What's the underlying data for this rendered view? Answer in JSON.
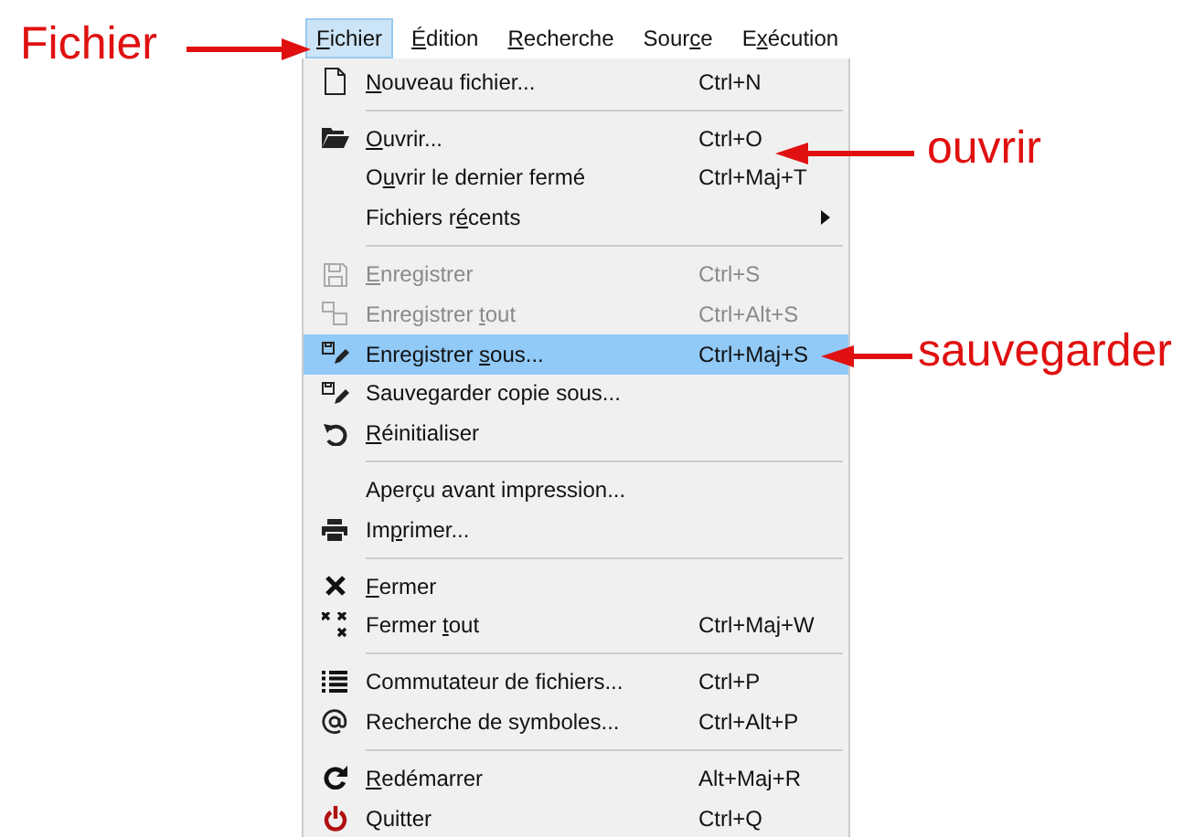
{
  "menubar": [
    {
      "label": "Fichier",
      "selected": true
    },
    {
      "label": "Édition",
      "selected": false
    },
    {
      "label": "Recherche",
      "selected": false
    },
    {
      "label": "Source",
      "selected": false
    },
    {
      "label": "Exécution",
      "selected": false
    }
  ],
  "menu": {
    "entries": [
      {
        "kind": "item",
        "label": "Nouveau fichier...",
        "shortcut": "Ctrl+N",
        "disabled": false,
        "selected": false
      },
      {
        "kind": "separator"
      },
      {
        "kind": "item",
        "label": "Ouvrir...",
        "shortcut": "Ctrl+O",
        "disabled": false,
        "selected": false
      },
      {
        "kind": "item",
        "label": "Ouvrir le dernier fermé",
        "shortcut": "Ctrl+Maj+T",
        "disabled": false,
        "selected": false
      },
      {
        "kind": "item",
        "label": "Fichiers récents",
        "submenu": true,
        "disabled": false,
        "selected": false
      },
      {
        "kind": "separator"
      },
      {
        "kind": "item",
        "label": "Enregistrer",
        "shortcut": "Ctrl+S",
        "disabled": true,
        "selected": false
      },
      {
        "kind": "item",
        "label": "Enregistrer tout",
        "shortcut": "Ctrl+Alt+S",
        "disabled": true,
        "selected": false
      },
      {
        "kind": "item",
        "label": "Enregistrer sous...",
        "shortcut": "Ctrl+Maj+S",
        "disabled": false,
        "selected": true
      },
      {
        "kind": "item",
        "label": "Sauvegarder copie sous...",
        "disabled": false,
        "selected": false
      },
      {
        "kind": "item",
        "label": "Réinitialiser",
        "disabled": false,
        "selected": false
      },
      {
        "kind": "separator"
      },
      {
        "kind": "item",
        "label": "Aperçu avant impression...",
        "disabled": false,
        "selected": false
      },
      {
        "kind": "item",
        "label": "Imprimer...",
        "disabled": false,
        "selected": false
      },
      {
        "kind": "separator"
      },
      {
        "kind": "item",
        "label": "Fermer",
        "disabled": false,
        "selected": false
      },
      {
        "kind": "item",
        "label": "Fermer tout",
        "shortcut": "Ctrl+Maj+W",
        "disabled": false,
        "selected": false
      },
      {
        "kind": "separator"
      },
      {
        "kind": "item",
        "label": "Commutateur de fichiers...",
        "shortcut": "Ctrl+P",
        "disabled": false,
        "selected": false
      },
      {
        "kind": "item",
        "label": "Recherche de symboles...",
        "shortcut": "Ctrl+Alt+P",
        "disabled": false,
        "selected": false
      },
      {
        "kind": "separator"
      },
      {
        "kind": "item",
        "label": "Redémarrer",
        "shortcut": "Alt+Maj+R",
        "disabled": false,
        "selected": false
      },
      {
        "kind": "item",
        "label": "Quitter",
        "shortcut": "Ctrl+Q",
        "disabled": false,
        "selected": false
      }
    ]
  },
  "annotations": [
    {
      "label": "Fichier"
    },
    {
      "label": "ouvrir"
    },
    {
      "label": "sauvegarder"
    }
  ]
}
